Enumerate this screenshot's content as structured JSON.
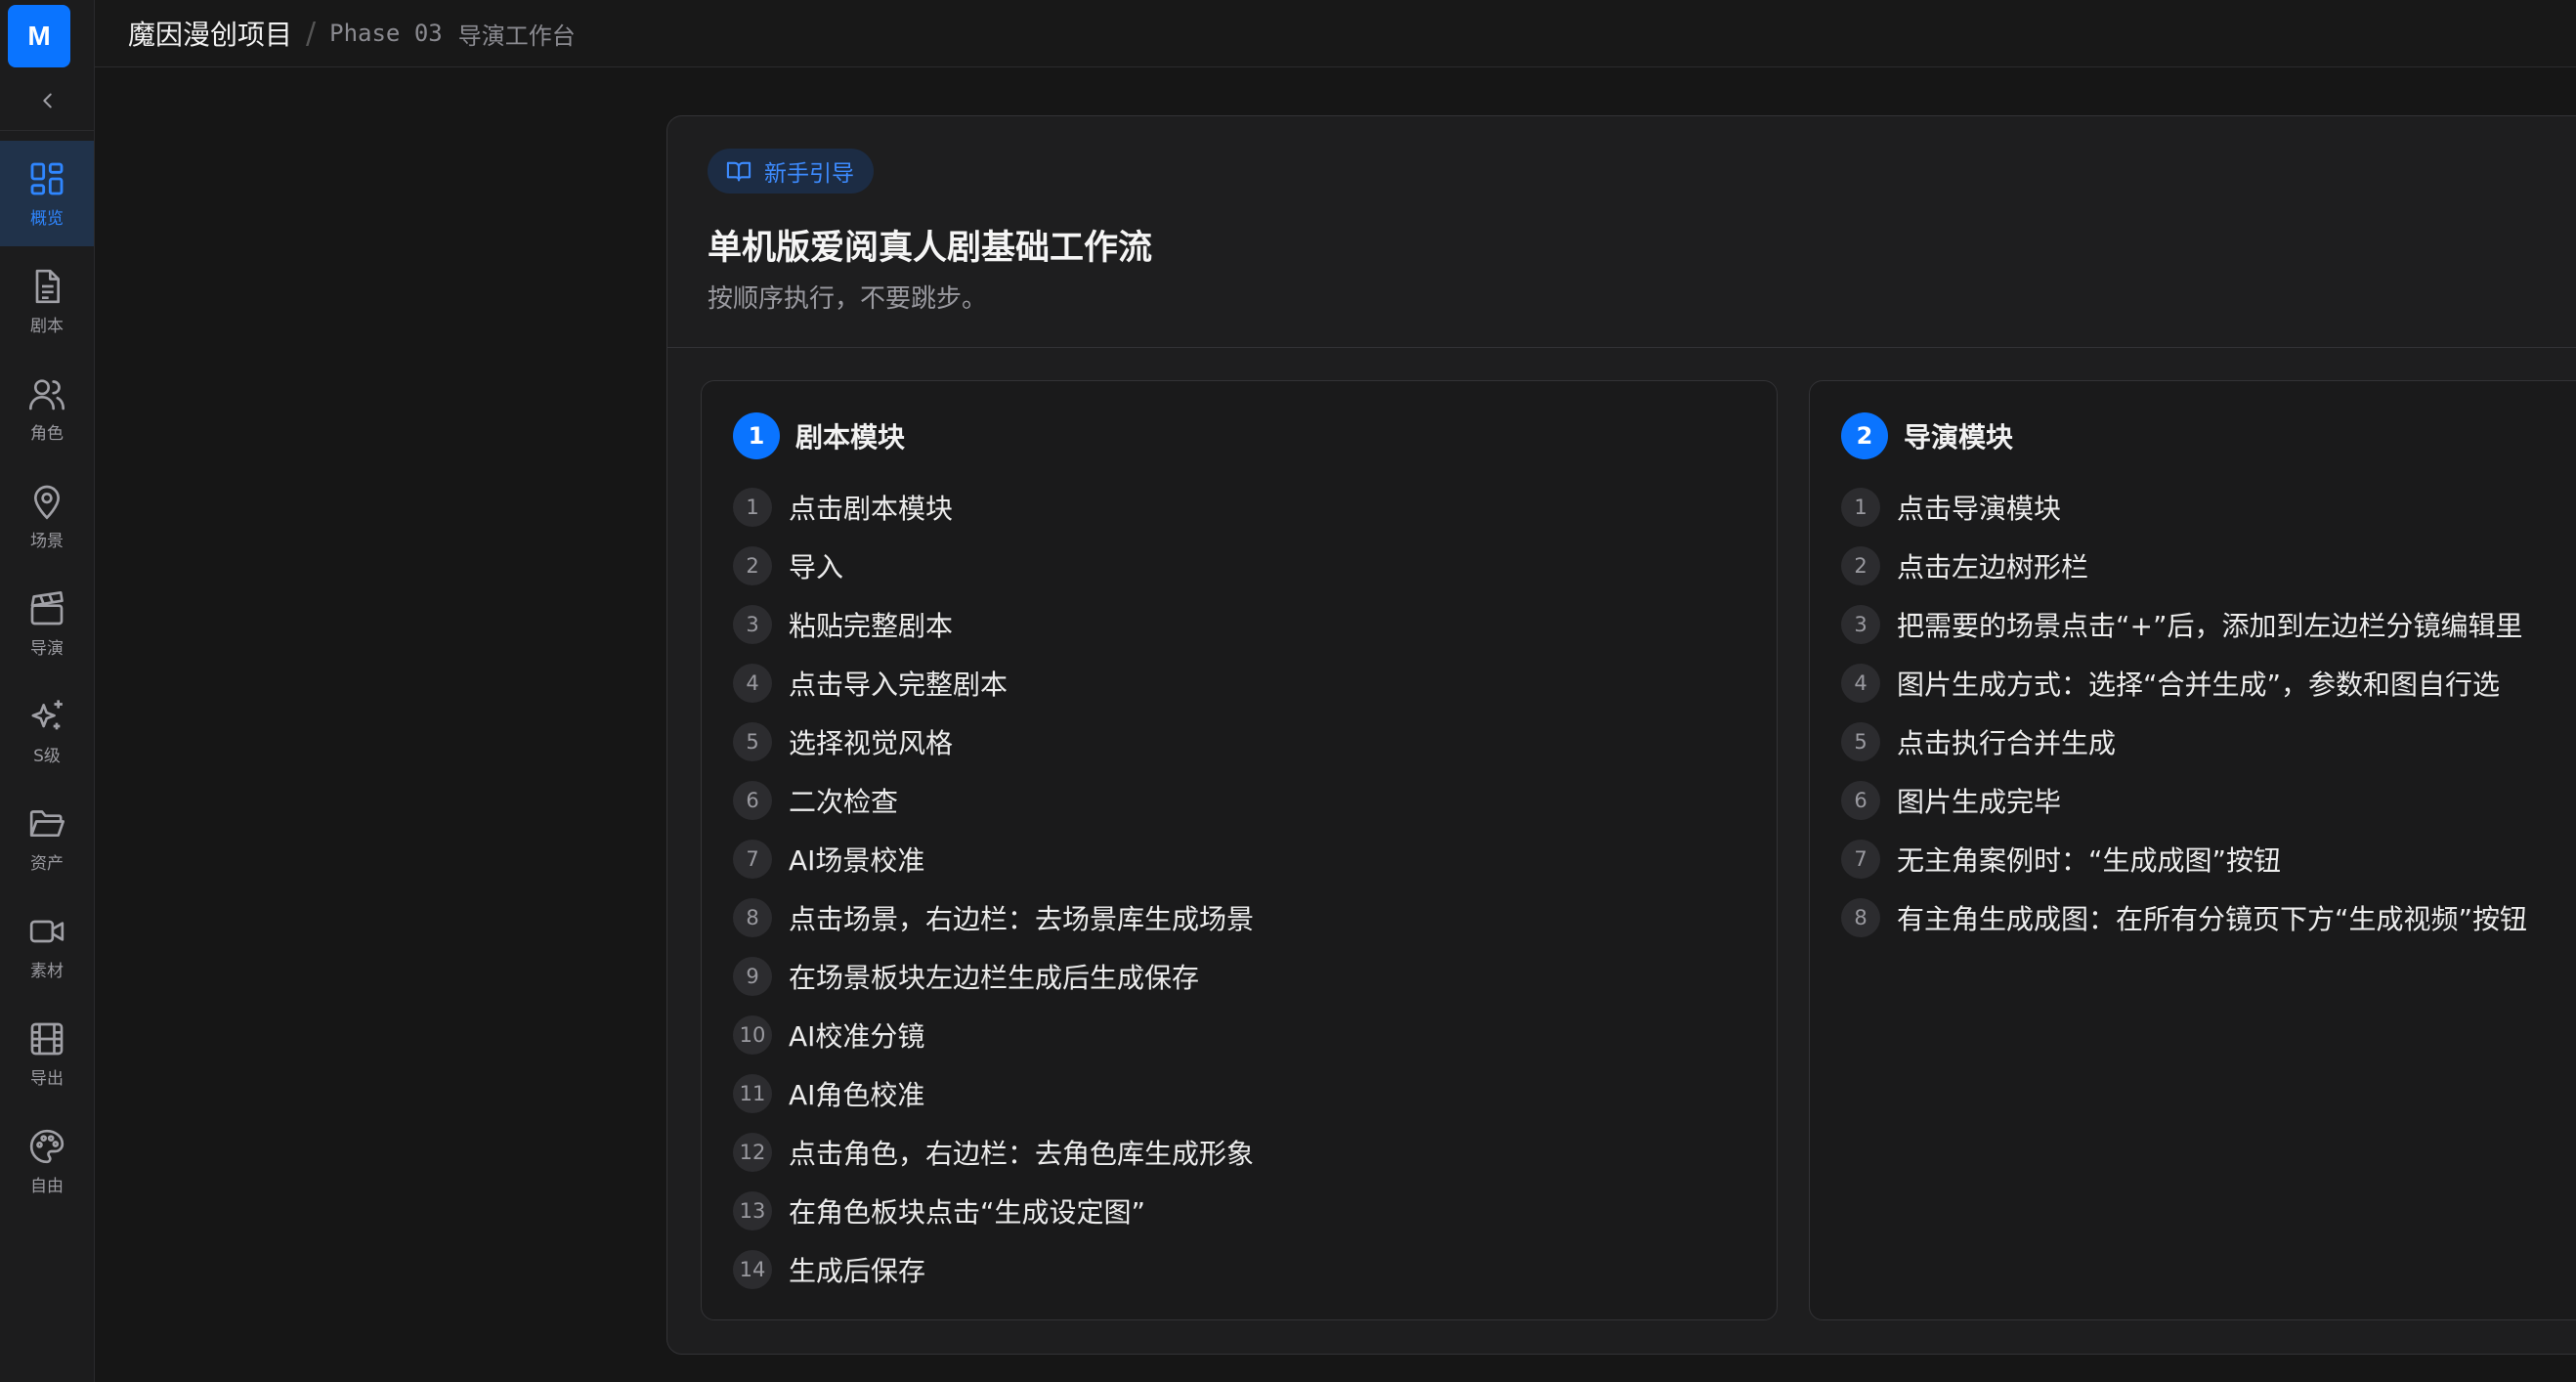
{
  "app": {
    "logo_letter": "M"
  },
  "sidebar": {
    "items": [
      {
        "label": "概览",
        "icon": "grid-icon",
        "active": true
      },
      {
        "label": "剧本",
        "icon": "document-icon"
      },
      {
        "label": "角色",
        "icon": "users-icon"
      },
      {
        "label": "场景",
        "icon": "map-pin-icon"
      },
      {
        "label": "导演",
        "icon": "clapperboard-icon"
      },
      {
        "label": "S级",
        "icon": "sparkles-icon"
      },
      {
        "label": "资产",
        "icon": "folder-icon"
      },
      {
        "label": "素材",
        "icon": "video-camera-icon"
      },
      {
        "label": "导出",
        "icon": "film-icon"
      },
      {
        "label": "自由",
        "icon": "palette-icon"
      }
    ]
  },
  "header": {
    "project": "魔因漫创项目",
    "separator": "/",
    "phase": "Phase 03",
    "page": "导演工作台"
  },
  "guide": {
    "badge": "新手引导",
    "title": "单机版爱阅真人剧基础工作流",
    "subtitle": "按顺序执行，不要跳步。"
  },
  "modules": [
    {
      "number": "1",
      "title": "剧本模块",
      "steps": [
        {
          "n": "1",
          "text": "点击剧本模块"
        },
        {
          "n": "2",
          "text": "导入"
        },
        {
          "n": "3",
          "text": "粘贴完整剧本"
        },
        {
          "n": "4",
          "text": "点击导入完整剧本"
        },
        {
          "n": "5",
          "text": "选择视觉风格"
        },
        {
          "n": "6",
          "text": "二次检查"
        },
        {
          "n": "7",
          "text": "AI场景校准"
        },
        {
          "n": "8",
          "text": "点击场景，右边栏：去场景库生成场景"
        },
        {
          "n": "9",
          "text": "在场景板块左边栏生成后生成保存"
        },
        {
          "n": "10",
          "text": "AI校准分镜"
        },
        {
          "n": "11",
          "text": "AI角色校准"
        },
        {
          "n": "12",
          "text": "点击角色，右边栏：去角色库生成形象"
        },
        {
          "n": "13",
          "text": "在角色板块点击“生成设定图”"
        },
        {
          "n": "14",
          "text": "生成后保存"
        }
      ]
    },
    {
      "number": "2",
      "title": "导演模块",
      "steps": [
        {
          "n": "1",
          "text": "点击导演模块"
        },
        {
          "n": "2",
          "text": "点击左边树形栏"
        },
        {
          "n": "3",
          "text": "把需要的场景点击“+”后，添加到左边栏分镜编辑里"
        },
        {
          "n": "4",
          "text": "图片生成方式：选择“合并生成”，参数和图自行选"
        },
        {
          "n": "5",
          "text": "点击执行合并生成"
        },
        {
          "n": "6",
          "text": "图片生成完毕"
        },
        {
          "n": "7",
          "text": "无主角案例时：“生成成图”按钮"
        },
        {
          "n": "8",
          "text": "有主角生成成图：在所有分镜页下方“生成视频”按钮"
        }
      ]
    }
  ],
  "colors": {
    "accent": "#0a74ff",
    "active_bg": "#20324a",
    "badge_bg": "#1c2c44"
  }
}
